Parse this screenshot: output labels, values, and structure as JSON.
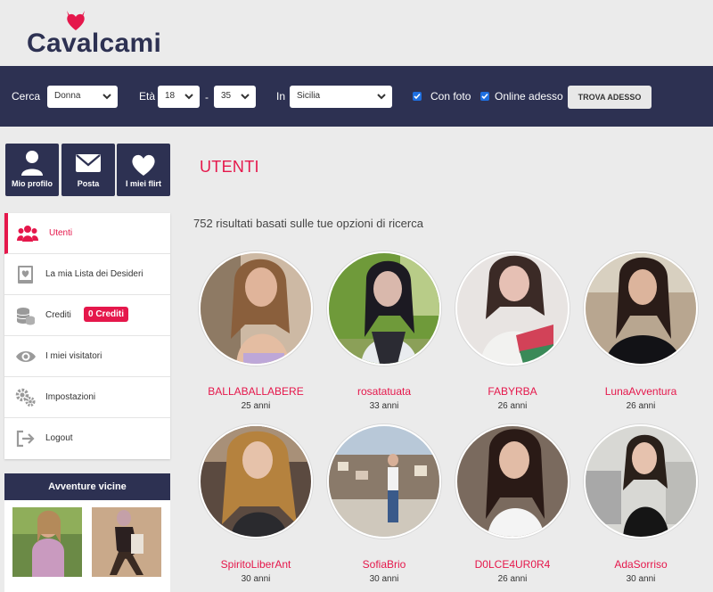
{
  "brand": {
    "name": "Cavalcami",
    "accent": "#e5174b",
    "navy": "#2d3152"
  },
  "search": {
    "label_cerca": "Cerca",
    "gender": "Donna",
    "label_eta": "Età",
    "age_min": "18",
    "dash": "-",
    "age_max": "35",
    "label_in": "In",
    "region": "Sicilia",
    "with_photo_label": "Con foto",
    "online_label": "Online adesso",
    "find_button": "TROVA ADESSO"
  },
  "quick_buttons": [
    {
      "label": "Mio profilo",
      "icon": "user-icon"
    },
    {
      "label": "Posta",
      "icon": "mail-icon"
    },
    {
      "label": "I miei flirt",
      "icon": "heart-icon"
    }
  ],
  "menu": [
    {
      "label": "Utenti",
      "icon": "users-icon"
    },
    {
      "label": "La mia Lista dei Desideri",
      "icon": "wishlist-icon"
    },
    {
      "label": "Crediti",
      "icon": "coins-icon",
      "badge": "0 Crediti"
    },
    {
      "label": "I miei visitatori",
      "icon": "eye-icon"
    },
    {
      "label": "Impostazioni",
      "icon": "gear-icon"
    },
    {
      "label": "Logout",
      "icon": "logout-icon"
    }
  ],
  "nearby": {
    "title": "Avventure vicine"
  },
  "main": {
    "title": "UTENTI",
    "results_text": "752 risultati basati sulle tue opzioni di ricerca"
  },
  "users": [
    {
      "name": "BALLABALLABERE",
      "age": "25 anni"
    },
    {
      "name": "rosatatuata",
      "age": "33 anni"
    },
    {
      "name": "FABYRBA",
      "age": "26 anni"
    },
    {
      "name": "LunaAvventura",
      "age": "26 anni"
    },
    {
      "name": "SpiritoLiberAnt",
      "age": "30 anni"
    },
    {
      "name": "SofiaBrio",
      "age": "30 anni"
    },
    {
      "name": "D0LCE4UR0R4",
      "age": "26 anni"
    },
    {
      "name": "AdaSorriso",
      "age": "30 anni"
    }
  ]
}
